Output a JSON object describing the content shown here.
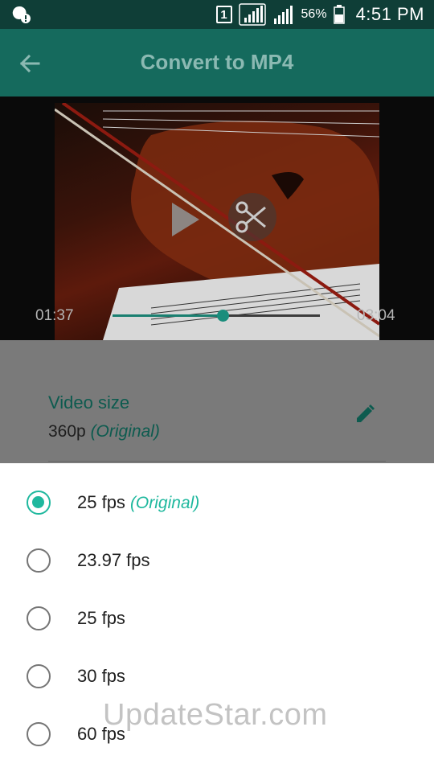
{
  "status_bar": {
    "sim_label": "1",
    "battery": "56%",
    "time": "4:51 PM"
  },
  "app_bar": {
    "title": "Convert to MP4"
  },
  "video": {
    "current_time": "01:37",
    "total_time": "03:04",
    "progress_fraction": 0.53
  },
  "settings": {
    "video_size_label": "Video size",
    "video_size_value": "360p",
    "video_size_note": "(Original)"
  },
  "frame_rate_options": [
    {
      "label": "25 fps",
      "note": "(Original)",
      "selected": true
    },
    {
      "label": "23.97 fps",
      "note": "",
      "selected": false
    },
    {
      "label": "25 fps",
      "note": "",
      "selected": false
    },
    {
      "label": "30 fps",
      "note": "",
      "selected": false
    },
    {
      "label": "60 fps",
      "note": "",
      "selected": false
    }
  ],
  "watermark": "UpdateStar.com",
  "colors": {
    "accent": "#1fb89e",
    "app_bar": "#156a5d",
    "status_bar": "#0f3e37"
  }
}
